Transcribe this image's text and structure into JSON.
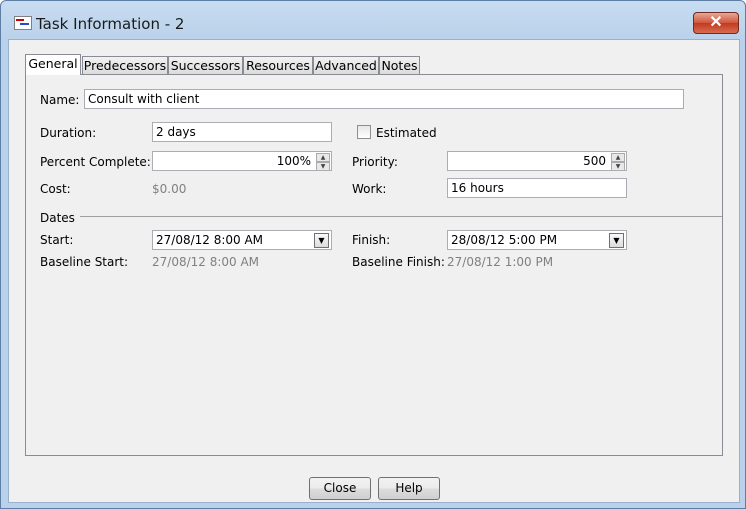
{
  "window": {
    "title": "Task Information - 2",
    "close_glyph": "✕"
  },
  "tabs": [
    {
      "label": "General"
    },
    {
      "label": "Predecessors"
    },
    {
      "label": "Successors"
    },
    {
      "label": "Resources"
    },
    {
      "label": "Advanced"
    },
    {
      "label": "Notes"
    }
  ],
  "general": {
    "name_label": "Name:",
    "name_value": "Consult with client",
    "duration_label": "Duration:",
    "duration_value": "2 days",
    "estimated_label": "Estimated",
    "percent_label": "Percent Complete:",
    "percent_value": "100%",
    "priority_label": "Priority:",
    "priority_value": "500",
    "cost_label": "Cost:",
    "cost_value": "$0.00",
    "work_label": "Work:",
    "work_value": "16 hours",
    "dates_label": "Dates",
    "start_label": "Start:",
    "start_value": "27/08/12 8:00 AM",
    "finish_label": "Finish:",
    "finish_value": "28/08/12 5:00 PM",
    "baseline_start_label": "Baseline Start:",
    "baseline_start_value": "27/08/12 8:00 AM",
    "baseline_finish_label": "Baseline Finish:",
    "baseline_finish_value": "27/08/12 1:00 PM"
  },
  "buttons": {
    "close": "Close",
    "help": "Help"
  },
  "icons": {
    "spin_up": "▲",
    "spin_down": "▼",
    "dropdown": "▼"
  }
}
